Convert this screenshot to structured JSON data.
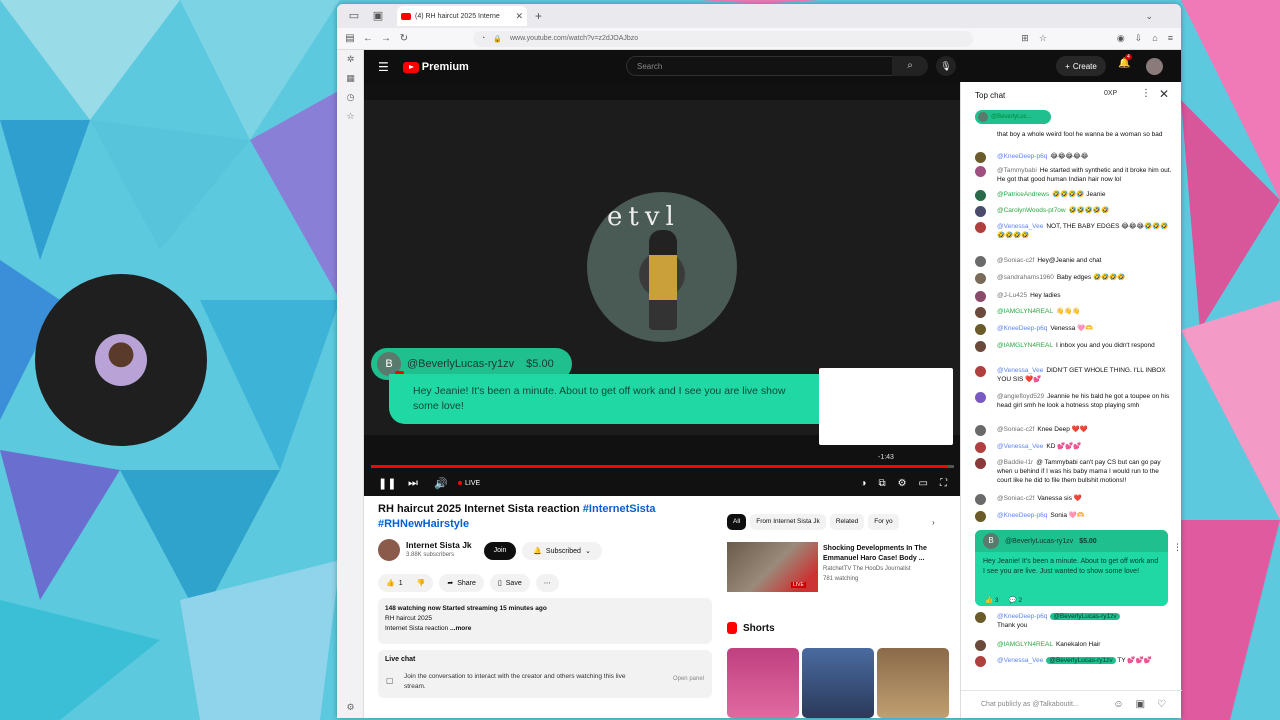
{
  "browser": {
    "tab_title": "(4) RH haircut 2025 Interne",
    "url": "www.youtube.com/watch?v=z2dJOAJbzo"
  },
  "masthead": {
    "logo": "Premium",
    "search_placeholder": "Search",
    "create_label": "Create",
    "notif_count": "4"
  },
  "player": {
    "superchat": {
      "avatar_letter": "B",
      "name": "@BeverlyLucas-ry1zv",
      "amount": "$5.00",
      "message": "Hey Jeanie! It's been a minute. About to get off work and I see you are live show some love!"
    },
    "time_tip": "-1:43",
    "live_label": "LIVE",
    "progress_fraction": 0.99
  },
  "video": {
    "title_plain": "RH haircut 2025 Internet Sista reaction ",
    "title_tag1": "#InternetSista",
    "title_tag2": "#RHNewHairstyle",
    "channel": "Internet Sista Jk",
    "subscribers": "3.88K subscribers",
    "join": "Join",
    "subscribed": "Subscribed",
    "likes": "1",
    "share": "Share",
    "save": "Save",
    "description": {
      "stats": "148 watching now  Started streaming 15 minutes ago",
      "line1": "RH haircut 2025",
      "line2": "Internet Sista reaction",
      "more": "...more"
    },
    "livechat": {
      "title": "Live chat",
      "text": "Join the conversation to interact with the creator and others watching this live stream.",
      "open": "Open panel"
    }
  },
  "recommend": {
    "chips": [
      "All",
      "From Internet Sista Jk",
      "Related",
      "For yo"
    ],
    "item": {
      "title": "Shocking Developments In The Emmanuel Haro Case! Body ...",
      "channel": "RatchetTV The HooDs Journalist",
      "watching": "781 watching",
      "badge": "LIVE"
    },
    "shorts_label": "Shorts"
  },
  "chat": {
    "header": "Top chat",
    "xp": "0XP",
    "ticker_name": "@BeverlyLuc...",
    "messages": [
      {
        "author": "",
        "text": "that boy a whole weird fool he wanna be a woman so bad",
        "cls": "",
        "color": "#888"
      },
      {
        "author": "@KneeDeep-p6q",
        "text": "😂😂😂😂😂",
        "cls": "mod",
        "color": "#6b5a2a"
      },
      {
        "author": "@Tammybabi",
        "text": "He started with synthetic and it broke him out. He got that good human Indian hair now lol",
        "cls": "",
        "color": "#a05080"
      },
      {
        "author": "@PatriceAndrews",
        "text": "🤣🤣🤣🤣 Jeanie",
        "cls": "mem",
        "color": "#2a6a4a"
      },
      {
        "author": "@CarolynWoods-pt7ow",
        "text": "🤣🤣🤣🤣🤣",
        "cls": "mem",
        "color": "#4a4a6a"
      },
      {
        "author": "@Venessa_Vee",
        "text": "NOT, THE BABY EDGES 😂😂😂🤣🤣🤣🤣🤣🤣🤣",
        "cls": "mod",
        "color": "#b04040"
      },
      {
        "author": "@Soniac-c2f",
        "text": "Hey@Jeanie and chat",
        "cls": "",
        "color": "#6a6a6a"
      },
      {
        "author": "@sandrahams1960",
        "text": "Baby edges 🤣🤣🤣🤣",
        "cls": "",
        "color": "#7a6a5a"
      },
      {
        "author": "@J-Lu425",
        "text": "Hey ladies",
        "cls": "",
        "color": "#8a4a6a"
      },
      {
        "author": "@IAMGLYN4REAL",
        "text": "👋👋👋",
        "cls": "mem",
        "color": "#6a4a3a"
      },
      {
        "author": "@KneeDeep-p6q",
        "text": "Venessa 🩷🫶",
        "cls": "mod",
        "color": "#6b5a2a"
      },
      {
        "author": "@IAMGLYN4REAL",
        "text": "I inbox you and you didn't respond",
        "cls": "mem",
        "color": "#6a4a3a"
      },
      {
        "author": "@Venessa_Vee",
        "text": "DIDN'T GET WHOLE THING. I'LL INBOX YOU SIS ❤️💕",
        "cls": "mod",
        "color": "#b04040"
      },
      {
        "author": "@angiefloyd529",
        "text": "Jeannie he his bald he got a toupee on his head girl smh he look a hotness stop playing smh",
        "cls": "",
        "color": "#7a5ac0"
      },
      {
        "author": "@Soniac-c2f",
        "text": "Knee Deep ❤️❤️",
        "cls": "",
        "color": "#6a6a6a"
      },
      {
        "author": "@Venessa_Vee",
        "text": "KD 💕💕💕",
        "cls": "mod",
        "color": "#b04040"
      },
      {
        "author": "@Baddie-l1r",
        "text": "@ Tammybabi can't pay CS but can go pay when u behind if I was his baby mama I would run to the court like he did to file them bullshit motions!!",
        "cls": "",
        "color": "#8a3a3a"
      },
      {
        "author": "@Soniac-c2f",
        "text": "Vanessa sis ❤️",
        "cls": "",
        "color": "#6a6a6a"
      },
      {
        "author": "@KneeDeep-p6q",
        "text": "Sonia 🩷🫶",
        "cls": "mod",
        "color": "#6b5a2a"
      }
    ],
    "sc_card": {
      "letter": "B",
      "name": "@BeverlyLucas-ry1zv",
      "amount": "$5.00",
      "text": "Hey Jeanie! It's been a minute. About to get off work and I see you are live. Just wanted to show some love!",
      "likes": "3",
      "replies": "2"
    },
    "after": [
      {
        "author": "@KneeDeep-p6q",
        "mention": "@BeverlyLucas-ry1zv",
        "text": "Thank you",
        "cls": "mod",
        "color": "#6b5a2a"
      },
      {
        "author": "@IAMGLYN4REAL",
        "mention": "",
        "text": "Kanekalon Hair",
        "cls": "mem",
        "color": "#6a4a3a"
      },
      {
        "author": "@Venessa_Vee",
        "mention": "@BeverlyLucas-ry1zv",
        "text": "TY 💕💕💕",
        "cls": "mod",
        "color": "#b04040"
      }
    ],
    "input_placeholder": "Chat publicly as @Talkaboutit..."
  }
}
